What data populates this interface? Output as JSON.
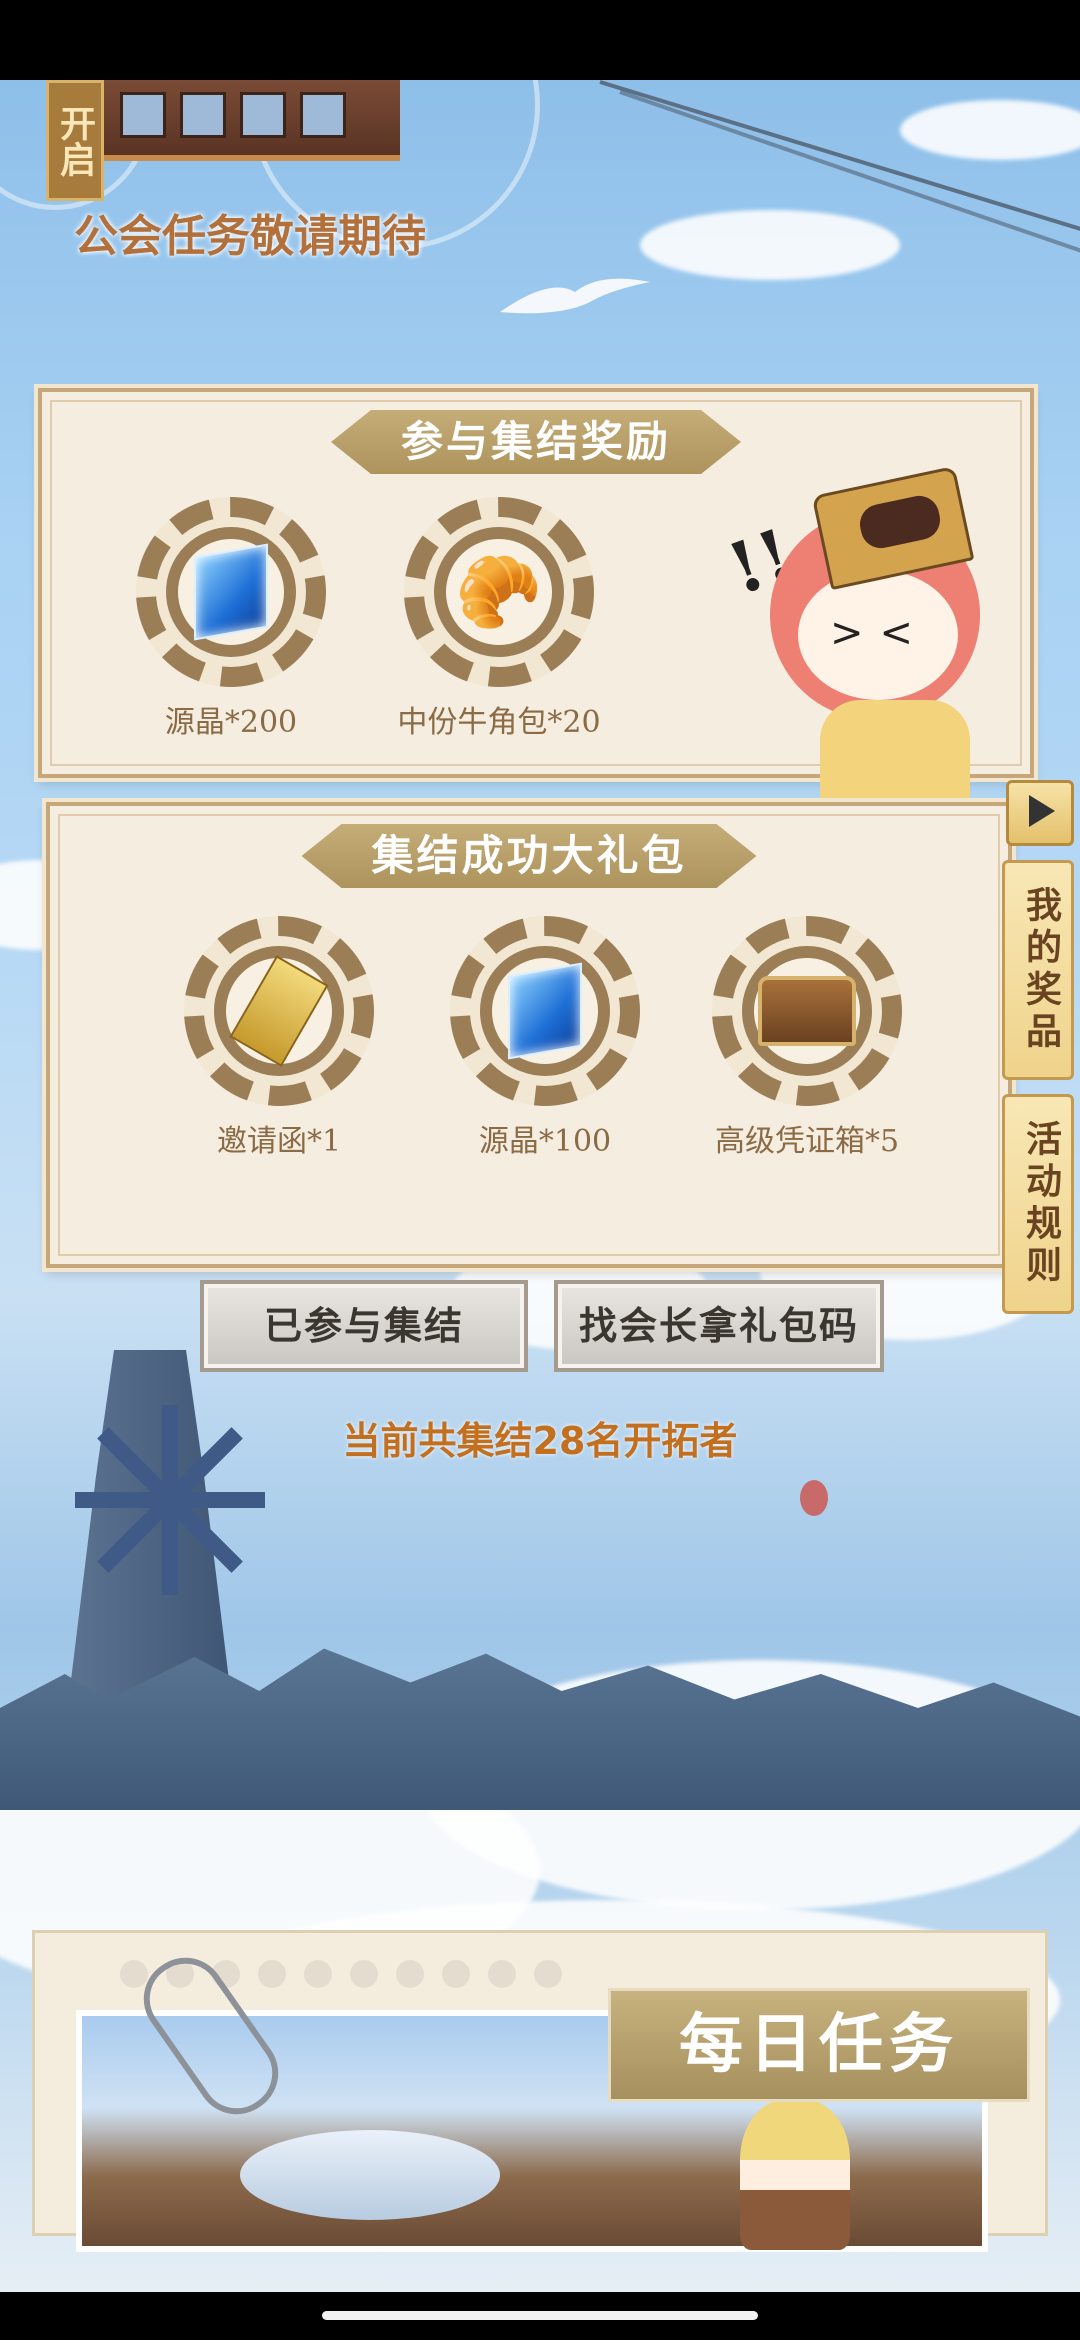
{
  "guild": {
    "banner": "开启",
    "message": "公会任务敬请期待"
  },
  "participation_panel": {
    "title": "参与集结奖励",
    "rewards": [
      {
        "label": "源晶*200",
        "icon": "crystal-icon"
      },
      {
        "label": "中份牛角包*20",
        "icon": "croissant-icon"
      }
    ]
  },
  "success_panel": {
    "title": "集结成功大礼包",
    "rewards": [
      {
        "label": "邀请函*1",
        "icon": "invitation-letter-icon"
      },
      {
        "label": "源晶*100",
        "icon": "crystal-icon"
      },
      {
        "label": "高级凭证箱*5",
        "icon": "treasure-chest-icon"
      }
    ]
  },
  "side_buttons": {
    "my_prizes": "我的奖品",
    "rules": "活动规则"
  },
  "actions": {
    "joined": "已参与集结",
    "find_leader": "找会长拿礼包码"
  },
  "status": {
    "count_text": "当前共集结28名开拓者"
  },
  "daily": {
    "title": "每日任务"
  }
}
